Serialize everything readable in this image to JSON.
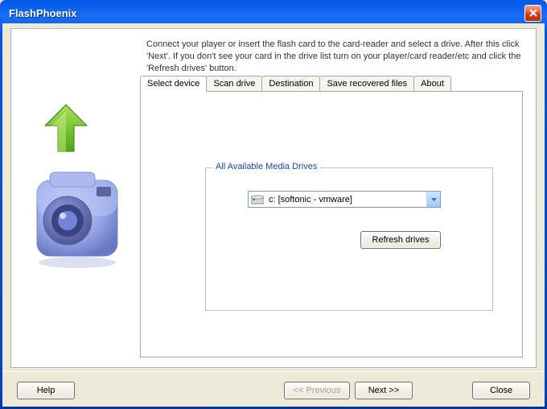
{
  "window": {
    "title": "FlashPhoenix"
  },
  "instructions": "Connect your player or insert the flash card to the card-reader and select a drive. After this click 'Next'. If you don't see your card in the drive list turn on your player/card reader/etc and click the 'Refresh drives' button.",
  "tabs": [
    {
      "label": "Select device",
      "active": true
    },
    {
      "label": "Scan drive",
      "active": false
    },
    {
      "label": "Destination",
      "active": false
    },
    {
      "label": "Save recovered files",
      "active": false
    },
    {
      "label": "About",
      "active": false
    }
  ],
  "groupbox": {
    "title": "All Available Media Drives"
  },
  "drive_select": {
    "selected": "c: [softonic - vmware]",
    "icon": "hard-drive-icon"
  },
  "buttons": {
    "refresh": "Refresh drives",
    "help": "Help",
    "previous": "<< Previous",
    "next": "Next >>",
    "close": "Close"
  },
  "colors": {
    "titlebar": "#0a5ae8",
    "client_bg": "#ece9d8",
    "link_blue": "#1a46aa"
  }
}
